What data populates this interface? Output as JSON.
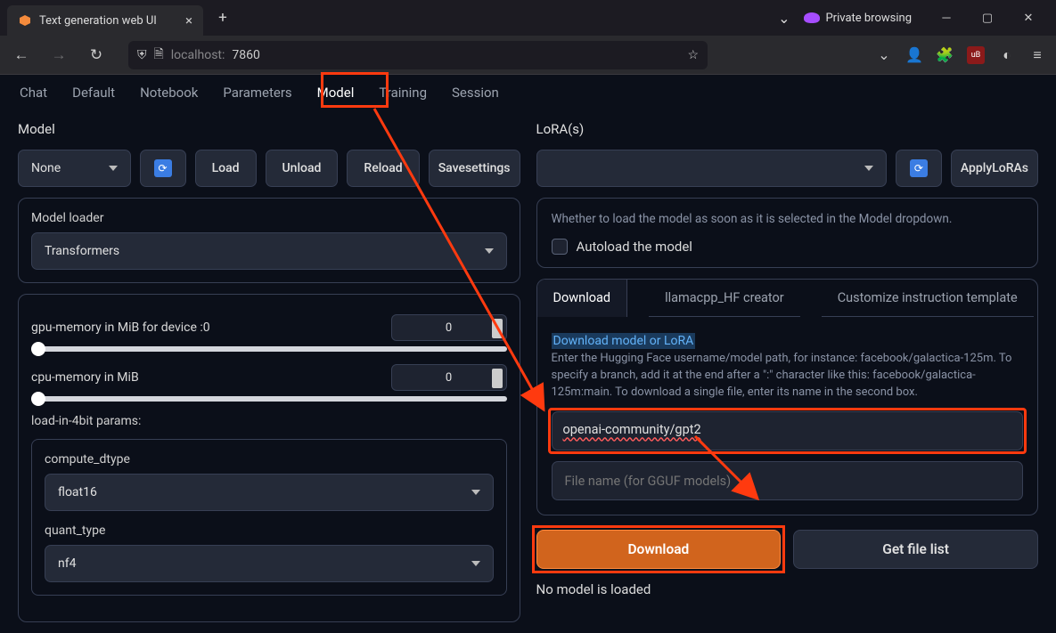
{
  "browser": {
    "tab_title": "Text generation web UI",
    "new_tab": "+",
    "private_label": "Private browsing",
    "url_host": "localhost:",
    "url_port": "7860"
  },
  "tabs": {
    "items": [
      "Chat",
      "Default",
      "Notebook",
      "Parameters",
      "Model",
      "Training",
      "Session"
    ],
    "active": "Model"
  },
  "left": {
    "model_label": "Model",
    "model_value": "None",
    "load_btn": "Load",
    "unload_btn": "Unload",
    "reload_btn": "Reload",
    "save_btn_l1": "Save",
    "save_btn_l2": "settings",
    "loader_label": "Model loader",
    "loader_value": "Transformers",
    "gpu_label": "gpu-memory in MiB for device :0",
    "gpu_value": "0",
    "cpu_label": "cpu-memory in MiB",
    "cpu_value": "0",
    "fourbit_label": "load-in-4bit params:",
    "compute_label": "compute_dtype",
    "compute_value": "float16",
    "quant_label": "quant_type",
    "quant_value": "nf4"
  },
  "right": {
    "lora_label": "LoRA(s)",
    "apply_lora_l1": "Apply",
    "apply_lora_l2": "LoRAs",
    "autoload_info": "Whether to load the model as soon as it is selected in the Model dropdown.",
    "autoload_label": "Autoload the model",
    "subtabs": [
      "Download",
      "llamacpp_HF creator",
      "Customize instruction template"
    ],
    "dl_title": "Download model or LoRA",
    "dl_desc": "Enter the Hugging Face username/model path, for instance: facebook/galactica-125m. To specify a branch, add it at the end after a \":\" character like this: facebook/galactica-125m:main. To download a single file, enter its name in the second box.",
    "dl_value": "openai-community/gpt2",
    "filename_placeholder": "File name (for GGUF models)",
    "download_btn": "Download",
    "filelist_btn": "Get file list",
    "status": "No model is loaded"
  }
}
